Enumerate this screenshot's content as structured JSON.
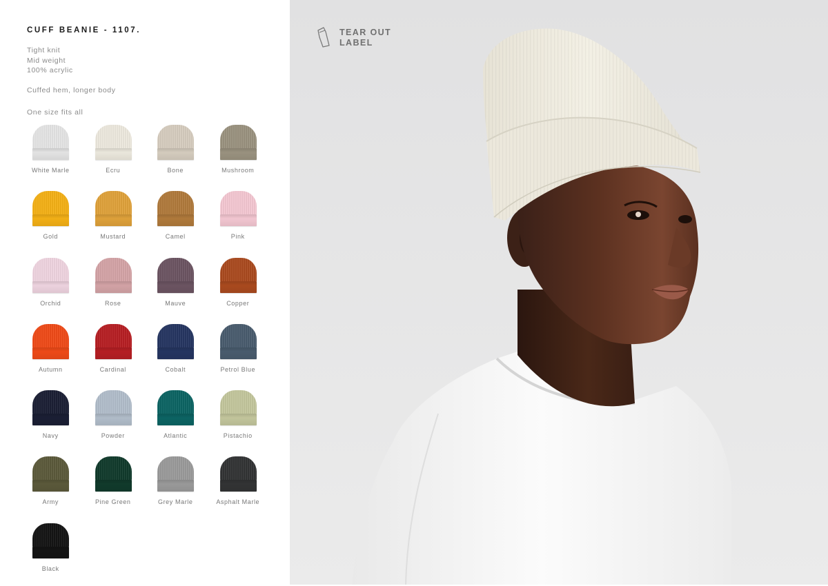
{
  "product": {
    "title": "CUFF BEANIE - 1107.",
    "specs": [
      "Tight knit",
      "Mid weight",
      "100% acrylic"
    ],
    "details": "Cuffed hem, longer body",
    "sizing": "One size fits all"
  },
  "colors": [
    {
      "name": "White Marle",
      "hex": "#e7e7e7"
    },
    {
      "name": "Ecru",
      "hex": "#efebe0"
    },
    {
      "name": "Bone",
      "hex": "#d8cfc1"
    },
    {
      "name": "Mushroom",
      "hex": "#9c9481"
    },
    {
      "name": "Gold",
      "hex": "#f6b216"
    },
    {
      "name": "Mustard",
      "hex": "#e1a33b"
    },
    {
      "name": "Camel",
      "hex": "#b27b3c"
    },
    {
      "name": "Pink",
      "hex": "#f6c9d4"
    },
    {
      "name": "Orchid",
      "hex": "#f1d6e2"
    },
    {
      "name": "Rose",
      "hex": "#d6a5a8"
    },
    {
      "name": "Mauve",
      "hex": "#6d5563"
    },
    {
      "name": "Copper",
      "hex": "#ac4b1f"
    },
    {
      "name": "Autumn",
      "hex": "#f14b18"
    },
    {
      "name": "Cardinal",
      "hex": "#b81f24"
    },
    {
      "name": "Cobalt",
      "hex": "#263662"
    },
    {
      "name": "Petrol Blue",
      "hex": "#4a5d6f"
    },
    {
      "name": "Navy",
      "hex": "#1b1f35"
    },
    {
      "name": "Powder",
      "hex": "#b3bfcc"
    },
    {
      "name": "Atlantic",
      "hex": "#0c6564"
    },
    {
      "name": "Pistachio",
      "hex": "#c5c89e"
    },
    {
      "name": "Army",
      "hex": "#5c5a3b"
    },
    {
      "name": "Pine Green",
      "hex": "#113b2c"
    },
    {
      "name": "Grey Marle",
      "hex": "#9c9c9c"
    },
    {
      "name": "Asphalt Marle",
      "hex": "#333435"
    },
    {
      "name": "Black",
      "hex": "#141414"
    }
  ],
  "photo": {
    "label_lines": [
      "TEAR OUT",
      "LABEL"
    ],
    "label_icon": "tear-out-label-icon",
    "model_image": "model-wearing-ecru-beanie"
  }
}
